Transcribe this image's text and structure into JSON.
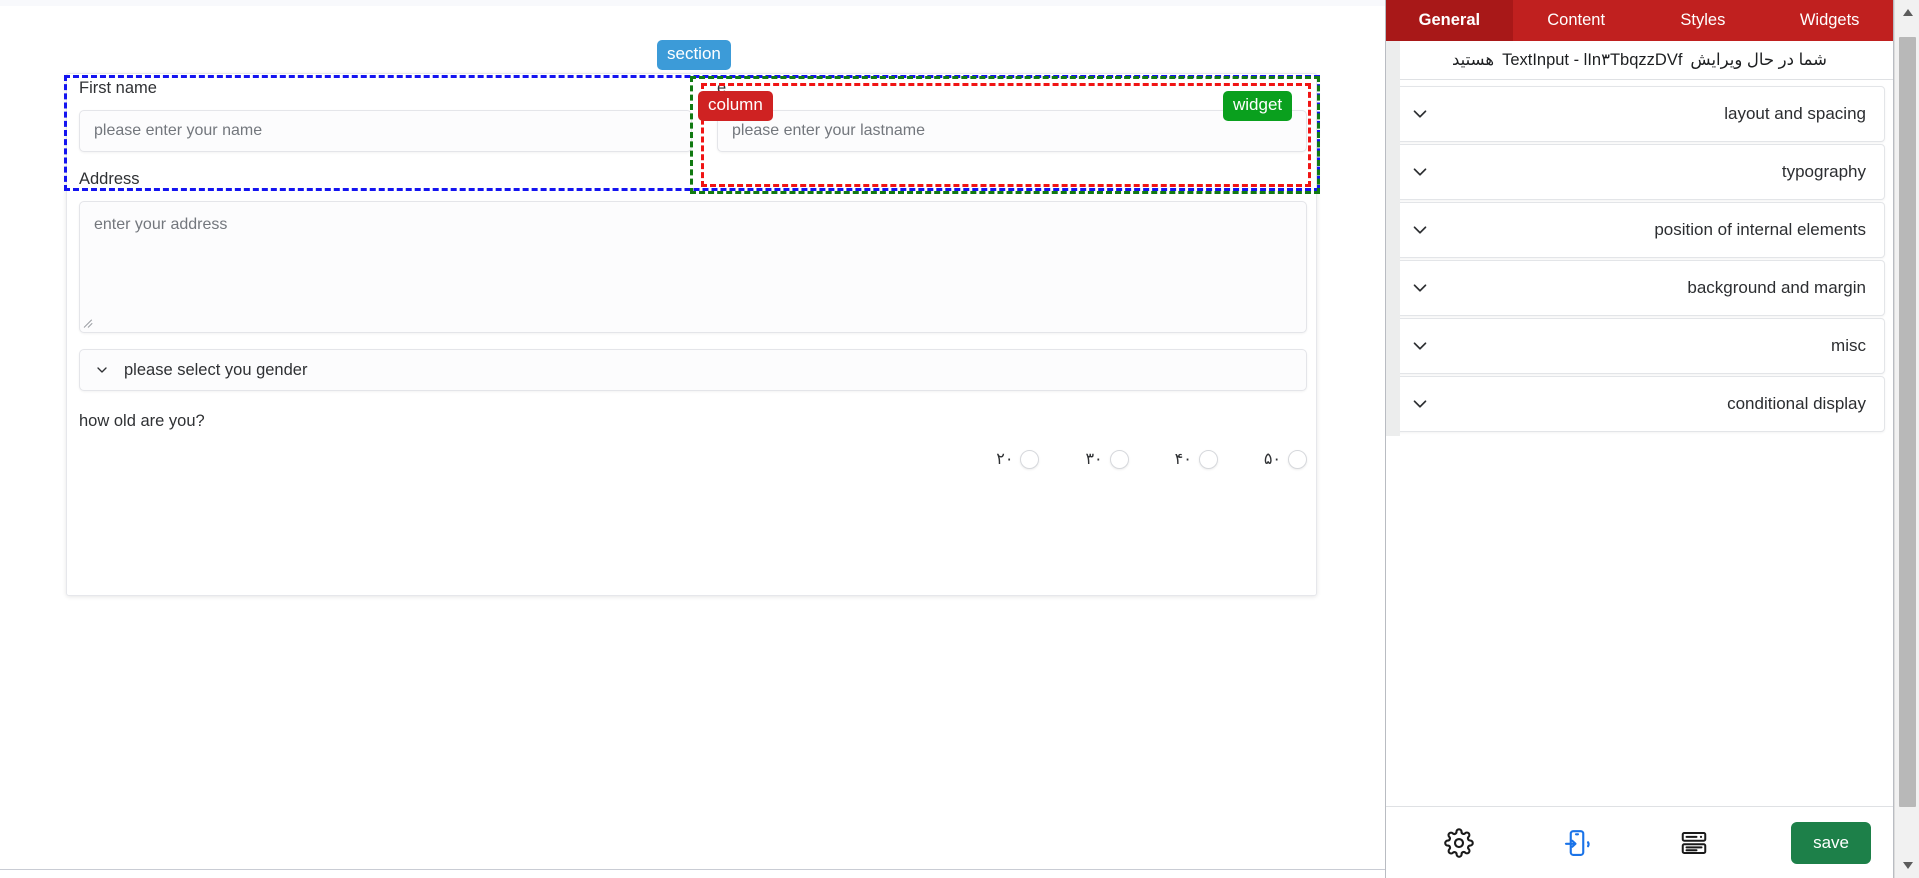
{
  "canvas": {
    "form": {
      "fields": {
        "first_name": {
          "label": "First name",
          "placeholder": "please enter your name"
        },
        "last_name": {
          "label": "e",
          "placeholder": "please enter your lastname"
        },
        "address": {
          "label": "Address",
          "placeholder": "enter your address"
        },
        "gender": {
          "selected": "please select you gender",
          "icon": "chevron-down-icon"
        },
        "age": {
          "label": "?how old are you",
          "options": [
            {
              "label": "۵۰",
              "checked": false
            },
            {
              "label": "۴۰",
              "checked": false
            },
            {
              "label": "۳۰",
              "checked": false
            },
            {
              "label": "۲۰",
              "checked": false
            }
          ]
        }
      }
    },
    "overlays": {
      "section_badge": "section",
      "column_badge": "column",
      "widget_badge": "widget",
      "section_color": "#3c9bd8",
      "column_color": "#cf2222",
      "widget_color": "#0aa01e",
      "outline_blue": "#1414f0",
      "outline_green": "#127a12",
      "outline_red": "#f01414"
    }
  },
  "panel": {
    "tabs": [
      {
        "label": "Widgets",
        "active": false
      },
      {
        "label": "Styles",
        "active": false
      },
      {
        "label": "Content",
        "active": false
      },
      {
        "label": "General",
        "active": true
      }
    ],
    "active_tab_color": "#a81818",
    "tabbar_color": "#c0201f",
    "subheader": {
      "prefix": "شما در حال ویرایش",
      "code": "TextInput - lIn۳TbqzzDVf",
      "suffix": "هستید"
    },
    "accordion": [
      {
        "label": "layout and spacing",
        "icon": "chevron-down-icon",
        "expanded": false
      },
      {
        "label": "typography",
        "icon": "chevron-down-icon",
        "expanded": false
      },
      {
        "label": "position of internal elements",
        "icon": "chevron-down-icon",
        "expanded": false
      },
      {
        "label": "background and margin",
        "icon": "chevron-down-icon",
        "expanded": false
      },
      {
        "label": "misc",
        "icon": "chevron-down-icon",
        "expanded": false
      },
      {
        "label": "conditional display",
        "icon": "chevron-down-icon",
        "expanded": false
      }
    ],
    "footer": {
      "save_label": "save",
      "save_color": "#1d8049",
      "icons": [
        {
          "name": "layers-list-icon",
          "color": "#1a1a1a"
        },
        {
          "name": "device-rotate-icon",
          "color": "#1a73e8"
        },
        {
          "name": "gear-icon",
          "color": "#1a1a1a"
        }
      ]
    }
  },
  "scrollbar": {
    "up_icon": "triangle-up-icon",
    "down_icon": "triangle-down-icon"
  }
}
